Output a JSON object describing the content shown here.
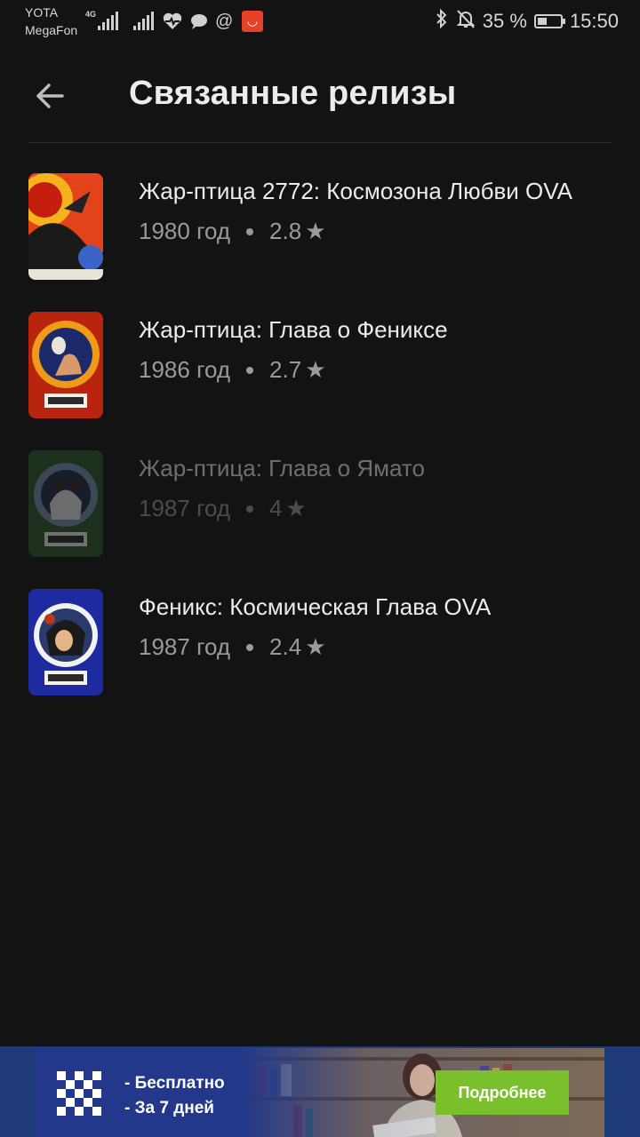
{
  "status_bar": {
    "carrier_1": "YOTA",
    "carrier_2": "MegaFon",
    "network_type": "4G",
    "battery_percent": "35 %",
    "time": "15:50",
    "icons": [
      "signal-icon",
      "heartbeat-icon",
      "chat-icon",
      "at-icon",
      "aliexpress-icon",
      "bluetooth-icon",
      "bell-off-icon",
      "battery-icon"
    ]
  },
  "header": {
    "back_icon": "arrow-left-icon",
    "title": "Связанные релизы"
  },
  "releases": [
    {
      "title": "Жар-птица 2772: Космозона Любви OVA",
      "year": "1980 год",
      "rating": "2.8",
      "dimmed": false
    },
    {
      "title": "Жар-птица: Глава о Фениксе",
      "year": "1986 год",
      "rating": "2.7",
      "dimmed": false
    },
    {
      "title": "Жар-птица: Глава о Ямато",
      "year": "1987 год",
      "rating": "4",
      "dimmed": true
    },
    {
      "title": "Феникс: Космическая Глава OVA",
      "year": "1987 год",
      "rating": "2.4",
      "dimmed": false
    }
  ],
  "rating_star": "★",
  "ad": {
    "line_1": "- Бесплатно",
    "line_2": "- За 7 дней",
    "button": "Подробнее",
    "accent_color": "#7ac02c",
    "background_color": "#23388a"
  }
}
